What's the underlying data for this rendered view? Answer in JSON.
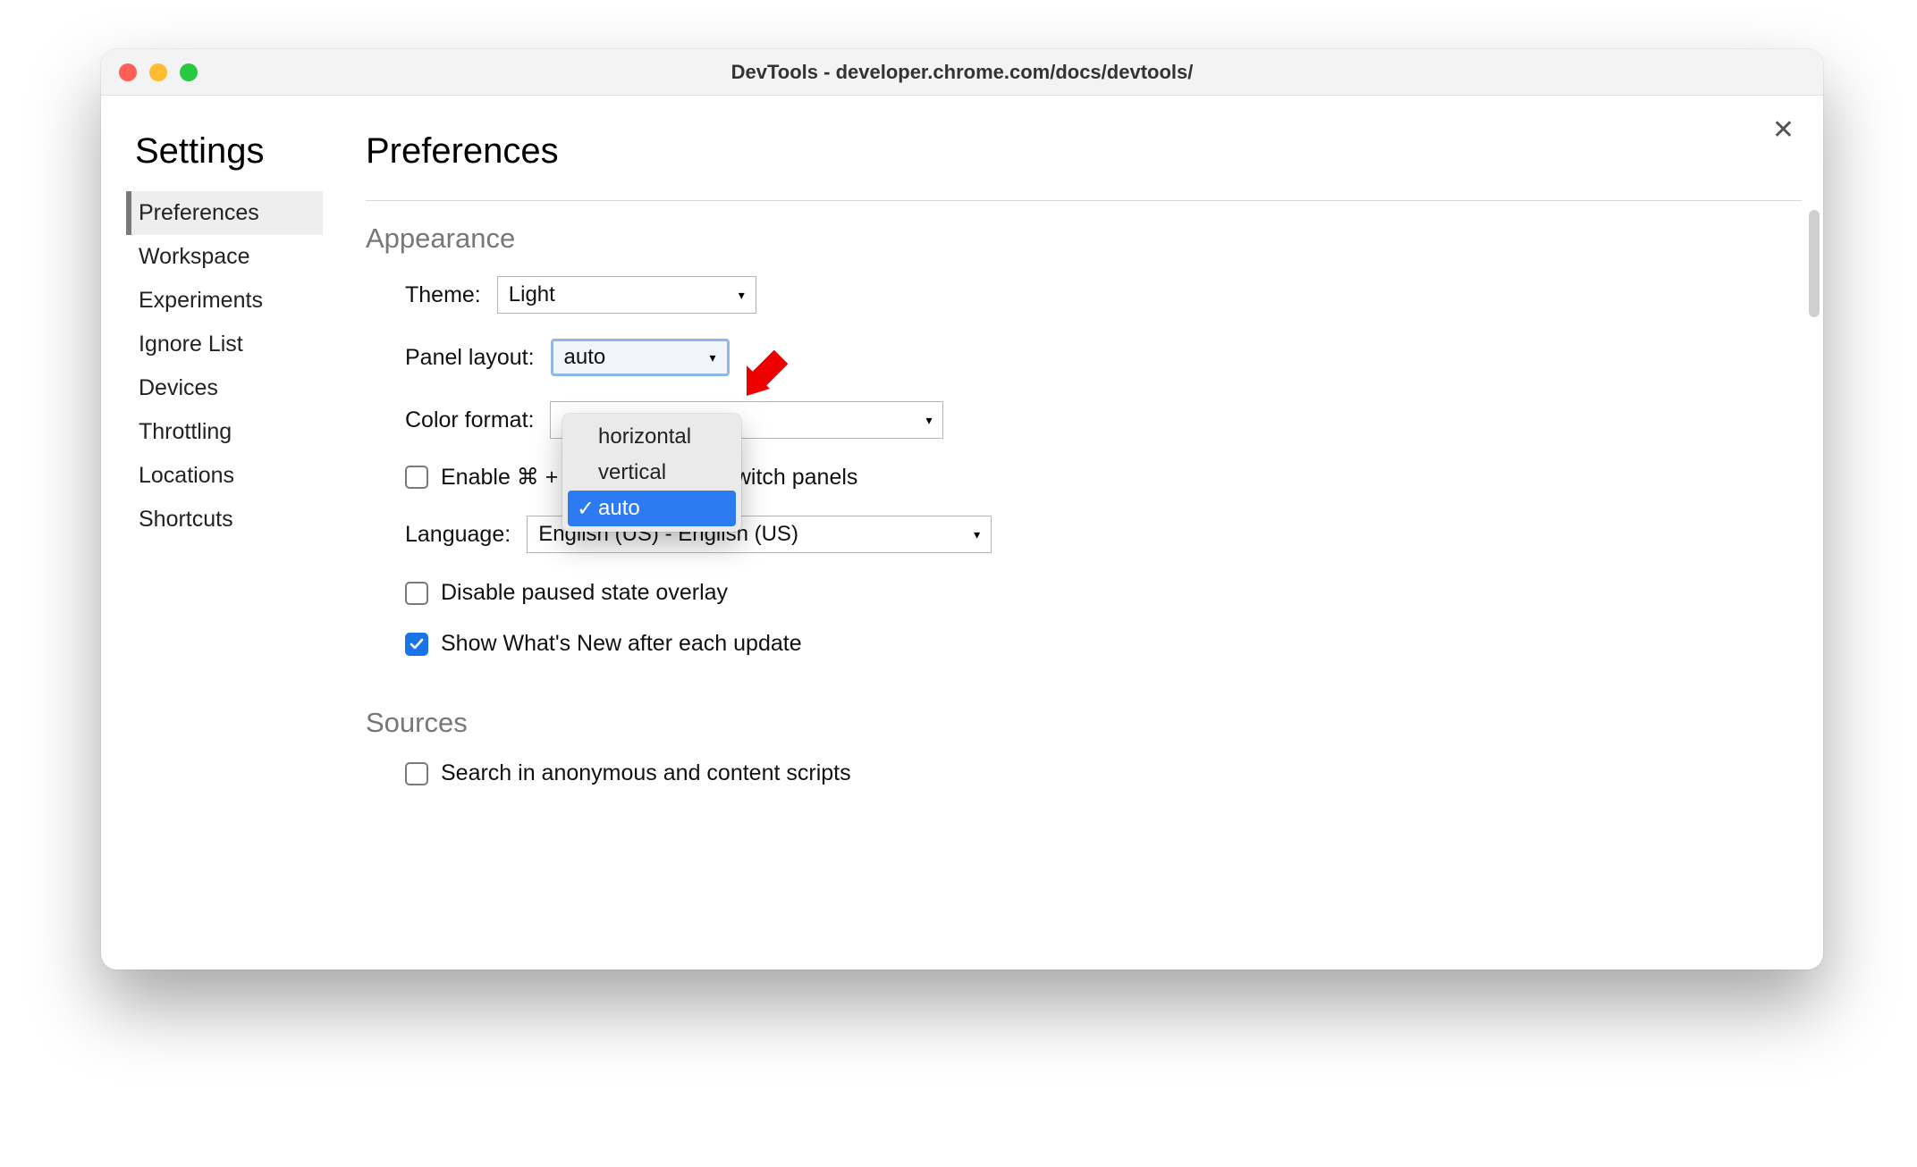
{
  "window": {
    "title": "DevTools - developer.chrome.com/docs/devtools/"
  },
  "settings_title": "Settings",
  "sidebar": {
    "items": [
      "Preferences",
      "Workspace",
      "Experiments",
      "Ignore List",
      "Devices",
      "Throttling",
      "Locations",
      "Shortcuts"
    ],
    "active_index": 0
  },
  "main": {
    "title": "Preferences",
    "appearance": {
      "heading": "Appearance",
      "theme_label": "Theme:",
      "theme_value": "Light",
      "panel_layout_label": "Panel layout:",
      "panel_layout_value": "auto",
      "panel_layout_options": [
        "horizontal",
        "vertical",
        "auto"
      ],
      "panel_layout_selected_index": 2,
      "color_format_label": "Color format:",
      "color_format_value": "",
      "enable_shortcut_prefix": "Enable ⌘ + ",
      "enable_shortcut_suffix": " switch panels",
      "enable_shortcut_checked": false,
      "language_label": "Language:",
      "language_value": "English (US) - English (US)",
      "disable_overlay_label": "Disable paused state overlay",
      "disable_overlay_checked": false,
      "show_whats_new_label": "Show What's New after each update",
      "show_whats_new_checked": true
    },
    "sources": {
      "heading": "Sources",
      "search_scripts_label": "Search in anonymous and content scripts",
      "search_scripts_checked": false
    }
  },
  "annotation": {
    "arrow_color": "#ed0000"
  }
}
